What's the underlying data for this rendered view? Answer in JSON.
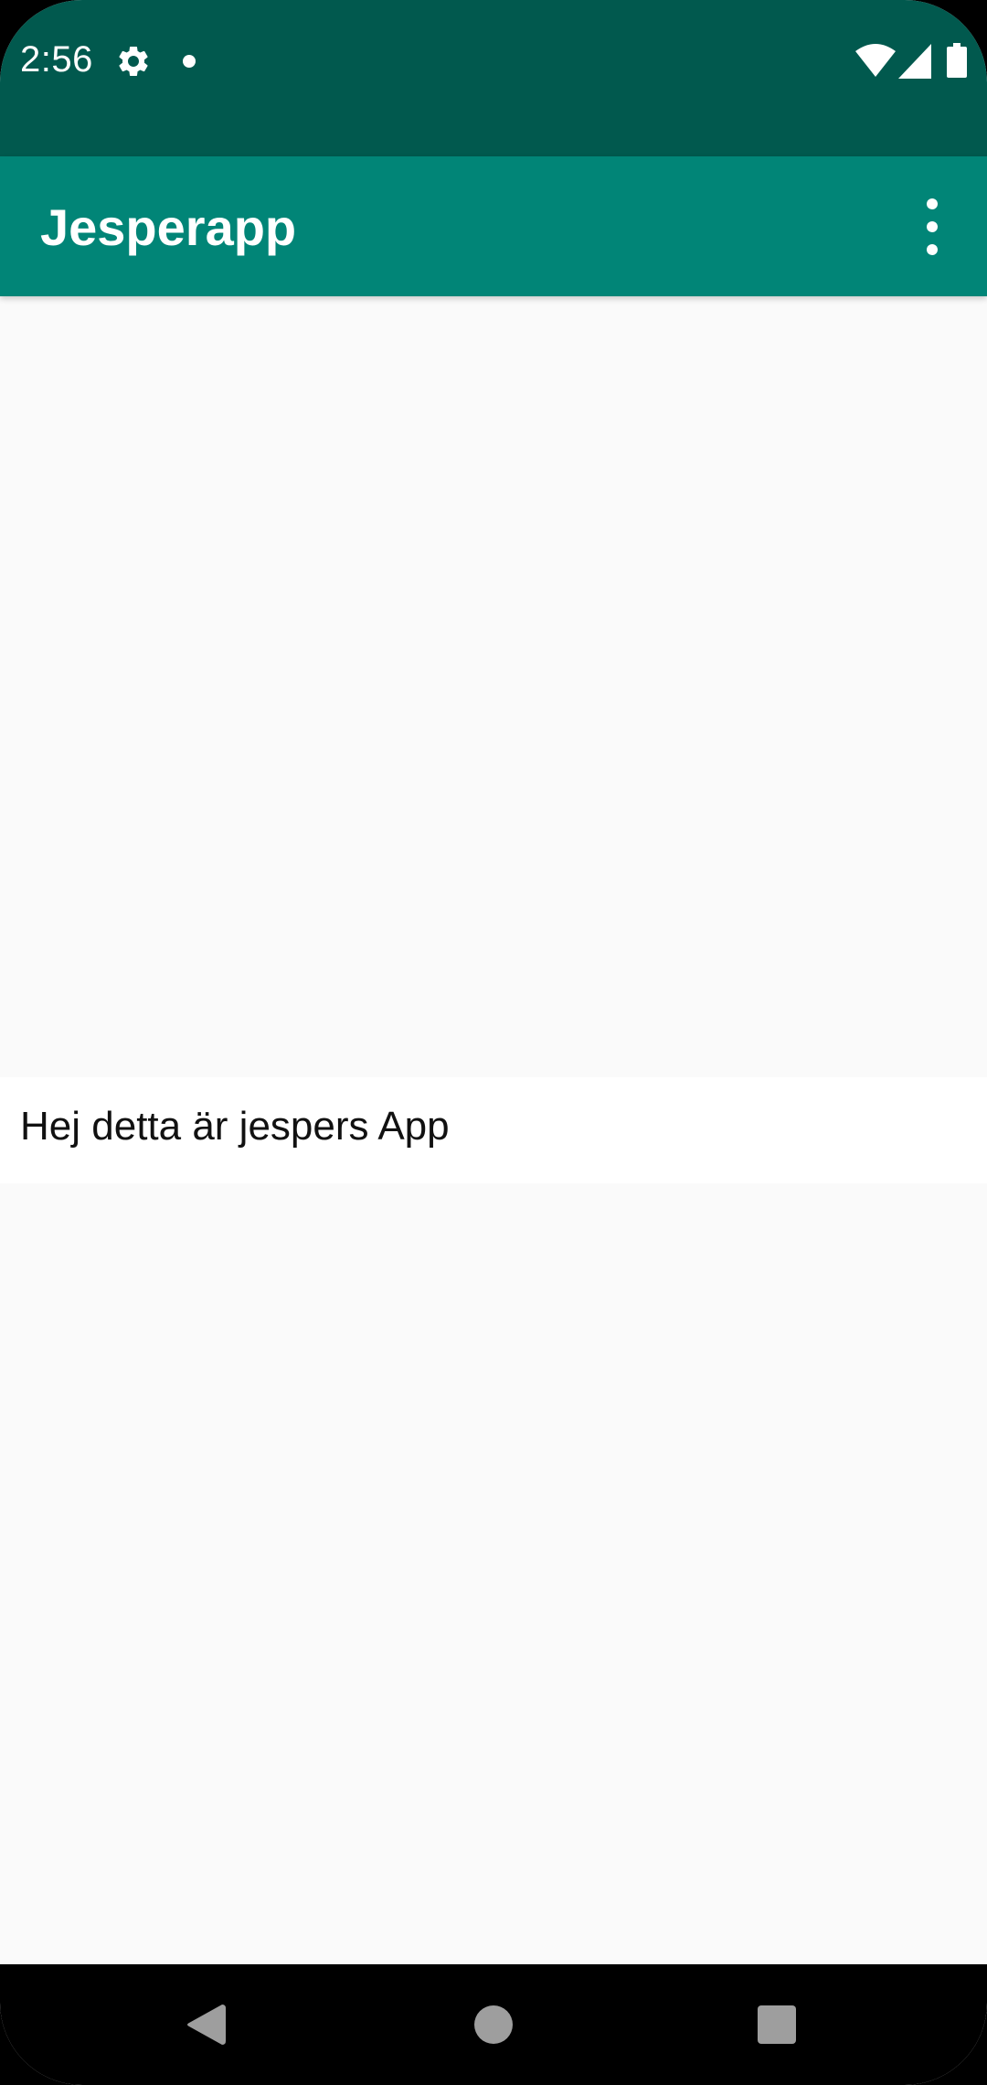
{
  "status_bar": {
    "time": "2:56",
    "icons": [
      "gear-icon",
      "notification-dot-icon",
      "wifi-icon",
      "cell-signal-icon",
      "battery-icon"
    ],
    "background_color": "#01594e"
  },
  "app_bar": {
    "title": "Jesperapp",
    "menu_icon": "overflow-menu-icon",
    "background_color": "#018577"
  },
  "main": {
    "text": "Hej detta är jespers App"
  },
  "navigation_bar": {
    "buttons": [
      "back-icon",
      "home-icon",
      "recents-icon"
    ]
  }
}
